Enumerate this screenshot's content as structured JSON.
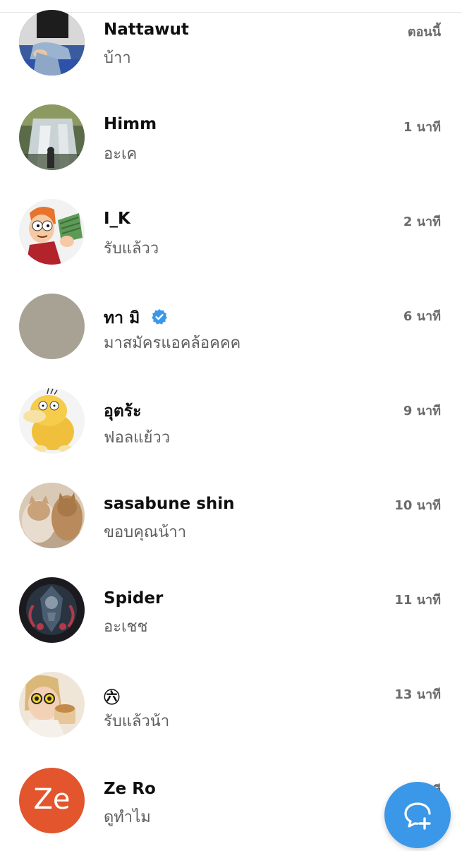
{
  "conversations": [
    {
      "name": "Nattawut",
      "message": "บ้าา",
      "time": "ตอนนี้",
      "avatar": "person-sitting-avatar",
      "verified": false
    },
    {
      "name": "Himm",
      "message": "อะเค",
      "time": "1 นาที",
      "avatar": "waterfall-avatar",
      "verified": false
    },
    {
      "name": "I_K",
      "message": "รับแล้วว",
      "time": "2 นาที",
      "avatar": "cartoon-money-avatar",
      "verified": false
    },
    {
      "name": "ทา มิ",
      "message": "มาสมัครแอคล้อคคค",
      "time": "6 นาที",
      "avatar": "gray-avatar",
      "verified": true
    },
    {
      "name": "อุตร้ะ",
      "message": "ฟอลแย้วว",
      "time": "9 นาที",
      "avatar": "yellow-duck-avatar",
      "verified": false
    },
    {
      "name": "sasabune shin",
      "message": "ขอบคุณน้าา",
      "time": "10 นาที",
      "avatar": "cats-avatar",
      "verified": false
    },
    {
      "name": "Spider",
      "message": "อะเชช",
      "time": "11 นาที",
      "avatar": "dark-art-avatar",
      "verified": false
    },
    {
      "name": "㊅",
      "message": "รับแล้วน้า",
      "time": "13 นาที",
      "avatar": "child-sunglasses-avatar",
      "verified": false
    },
    {
      "name": "Ze Ro",
      "message": "ดูทำไม",
      "time": "1 นาที",
      "avatar": "initials-avatar",
      "initials": "Ze",
      "verified": false
    }
  ],
  "colors": {
    "fab": "#3b97e8",
    "verified": "#3b97e8",
    "initials_avatar_bg": "#e2552d"
  },
  "fab_icon": "new-message-icon"
}
